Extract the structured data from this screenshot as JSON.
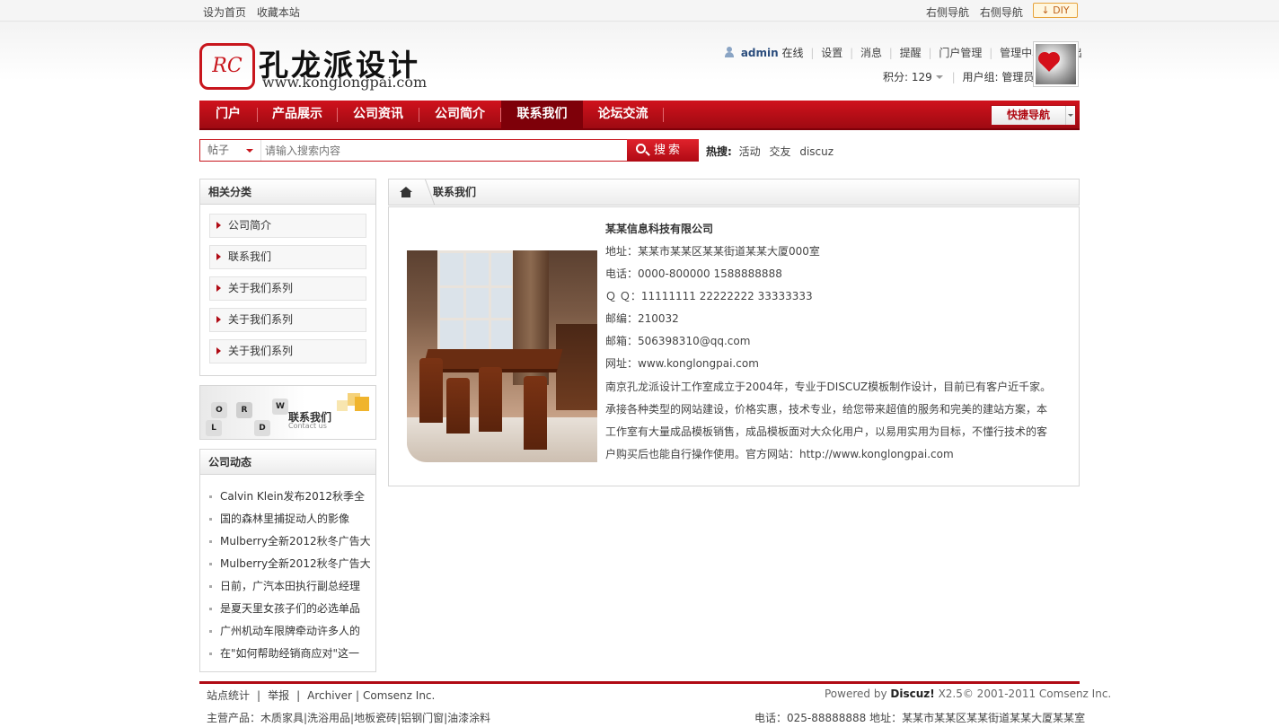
{
  "topbar": {
    "links": [
      "设为首页",
      "收藏本站"
    ],
    "right_links": [
      "右侧导航",
      "右侧导航"
    ],
    "diy": "DIY"
  },
  "logo": {
    "cn": "孔龙派设计",
    "url": "www.konglongpai.com",
    "mark": "RC"
  },
  "user": {
    "name": "admin",
    "status": "在线",
    "links": [
      "设置",
      "消息",
      "提醒",
      "门户管理",
      "管理中心",
      "退出"
    ],
    "points_label": "积分: 129",
    "group_label": "用户组: 管理员"
  },
  "nav": {
    "items": [
      "门户",
      "产品展示",
      "公司资讯",
      "公司简介",
      "联系我们",
      "论坛交流"
    ],
    "active_index": 4,
    "quick": "快捷导航"
  },
  "search": {
    "type": "帖子",
    "placeholder": "请输入搜索内容",
    "button": "搜索",
    "hot_label": "热搜:",
    "hot": [
      "活动",
      "交友",
      "discuz"
    ]
  },
  "sidebar": {
    "category_title": "相关分类",
    "categories": [
      "公司简介",
      "联系我们",
      "关于我们系列",
      "关于我们系列",
      "关于我们系列"
    ],
    "banner_title": "联系我们",
    "banner_sub": "Contact us",
    "banner_letters": [
      "O",
      "R",
      "W",
      "L",
      "D"
    ],
    "news_title": "公司动态",
    "news": [
      "Calvin Klein发布2012秋季全",
      "国的森林里捕捉动人的影像",
      "Mulberry全新2012秋冬广告大",
      "Mulberry全新2012秋冬广告大",
      "日前，广汽本田执行副总经理",
      "是夏天里女孩子们的必选单品",
      "广州机动车限牌牵动许多人的",
      "在\"如何帮助经销商应对\"这一"
    ]
  },
  "breadcrumb": {
    "current": "联系我们"
  },
  "contact": {
    "company": "某某信息科技有限公司",
    "lines": [
      "地址：某某市某某区某某街道某某大厦000室",
      "电话：0000-800000 1588888888",
      "Ｑ Ｑ：11111111  22222222 33333333",
      "邮编：210032",
      "邮箱：506398310@qq.com",
      "网址：www.konglongpai.com"
    ],
    "description": "南京孔龙派设计工作室成立于2004年，专业于DISCUZ模板制作设计，目前已有客户近千家。承接各种类型的网站建设，价格实惠，技术专业，给您带来超值的服务和完美的建站方案，本工作室有大量成品模板销售，成品模板面对大众化用户，以易用实用为目标，不懂行技术的客户购买后也能自行操作使用。官方网站：http://www.konglongpai.com"
  },
  "footer": {
    "links": [
      "站点统计",
      "举报",
      "Archiver",
      "Comsenz Inc."
    ],
    "powered_prefix": "Powered by",
    "powered_brand": "Discuz!",
    "powered_suffix": "X2.5© 2001-2011 Comsenz Inc.",
    "products": "主营产品：木质家具|洗浴用品|地板瓷砖|铝钢门窗|油漆涂料",
    "contact": "电话：025-88888888 地址：某某市某某区某某街道某某大厦某某室"
  },
  "colors": {
    "brand_red": "#b00a14",
    "nav_active": "#7e0009"
  }
}
